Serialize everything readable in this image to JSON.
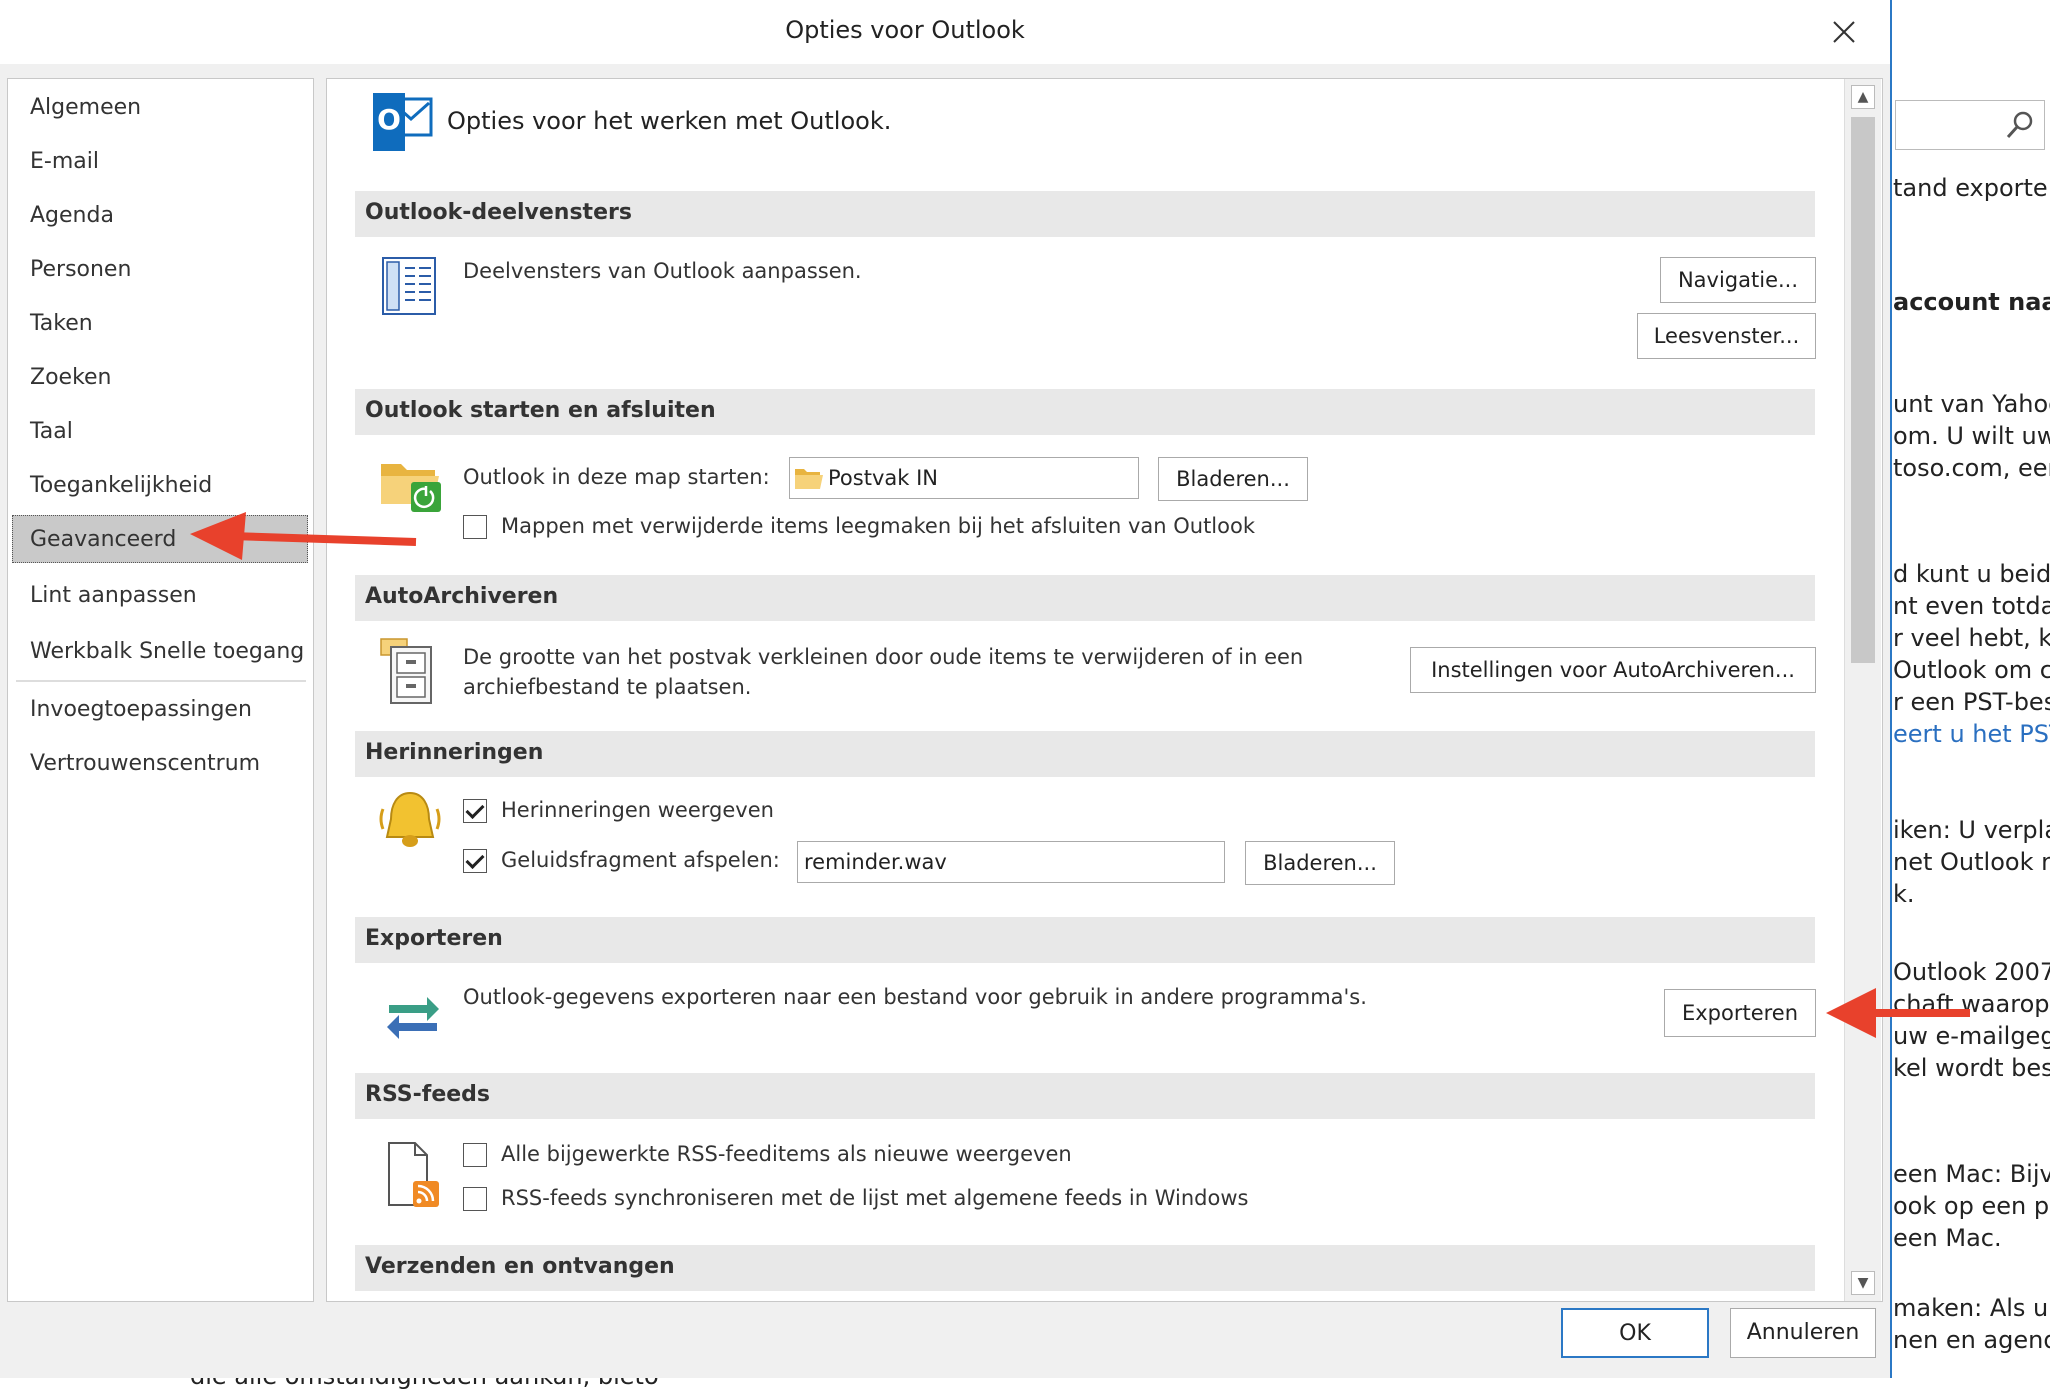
{
  "background": {
    "lines": [
      {
        "text": "tand exporte",
        "cls": ""
      },
      {
        "text": "account naar",
        "cls": "bold"
      },
      {
        "text": "unt van Yahoo",
        "cls": ""
      },
      {
        "text": "om. U wilt uw",
        "cls": ""
      },
      {
        "text": "toso.com, een",
        "cls": ""
      },
      {
        "text": "d kunt u beid",
        "cls": ""
      },
      {
        "text": "nt even totdat",
        "cls": ""
      },
      {
        "text": "r veel hebt, ka",
        "cls": ""
      },
      {
        "text": "Outlook om c",
        "cls": ""
      },
      {
        "text": "r een PST-bes",
        "cls": ""
      },
      {
        "text": "eert u het PST-",
        "cls": "link"
      },
      {
        "text": "iken: U verpla",
        "cls": "mixed"
      },
      {
        "text": "net Outlook na",
        "cls": ""
      },
      {
        "text": "k.",
        "cls": ""
      },
      {
        "text": "Outlook 2007",
        "cls": ""
      },
      {
        "text": "chaft waarop O",
        "cls": ""
      },
      {
        "text": "uw e-mailgeg",
        "cls": ""
      },
      {
        "text": "kel wordt besc",
        "cls": ""
      },
      {
        "text": "een Mac: Bijvo",
        "cls": "mixed"
      },
      {
        "text": "ook op een pc",
        "cls": ""
      },
      {
        "text": "een Mac.",
        "cls": ""
      },
      {
        "text": "maken: Als u w",
        "cls": "mixed"
      },
      {
        "text": "nen en agend",
        "cls": ""
      }
    ],
    "bottom_fragment": "die alle omstandigheden aankan, bieto"
  },
  "dialog": {
    "title": "Opties voor Outlook",
    "nav": [
      "Algemeen",
      "E-mail",
      "Agenda",
      "Personen",
      "Taken",
      "Zoeken",
      "Taal",
      "Toegankelijkheid",
      "Geavanceerd",
      "Lint aanpassen",
      "Werkbalk Snelle toegang",
      "Invoegtoepassingen",
      "Vertrouwenscentrum"
    ],
    "selected_nav": "Geavanceerd",
    "header": "Opties voor het werken met Outlook.",
    "sections": {
      "panes": {
        "title": "Outlook-deelvensters",
        "text": "Deelvensters van Outlook aanpassen.",
        "btn_nav": "Navigatie...",
        "btn_read": "Leesvenster..."
      },
      "start": {
        "title": "Outlook starten en afsluiten",
        "label": "Outlook in deze map starten:",
        "folder": "Postvak IN",
        "browse": "Bladeren...",
        "empty_deleted": "Mappen met verwijderde items leegmaken bij het afsluiten van Outlook"
      },
      "autoarchive": {
        "title": "AutoArchiveren",
        "text1": "De grootte van het postvak verkleinen door oude items te verwijderen of in een",
        "text2": "archiefbestand te plaatsen.",
        "button": "Instellingen voor AutoArchiveren..."
      },
      "reminders": {
        "title": "Herinneringen",
        "show": "Herinneringen weergeven",
        "play": "Geluidsfragment afspelen:",
        "sound": "reminder.wav",
        "browse": "Bladeren..."
      },
      "export": {
        "title": "Exporteren",
        "text": "Outlook-gegevens exporteren naar een bestand voor gebruik in andere programma's.",
        "button": "Exporteren"
      },
      "rss": {
        "title": "RSS-feeds",
        "opt1": "Alle bijgewerkte RSS-feeditems als nieuwe weergeven",
        "opt2": "RSS-feeds synchroniseren met de lijst met algemene feeds in Windows"
      },
      "sendreceive": {
        "title": "Verzenden en ontvangen"
      }
    },
    "ok": "OK",
    "cancel": "Annuleren"
  },
  "colors": {
    "accent": "#2b78c5",
    "arrow": "#e8412c",
    "outlook_blue": "#0f6cbd"
  }
}
